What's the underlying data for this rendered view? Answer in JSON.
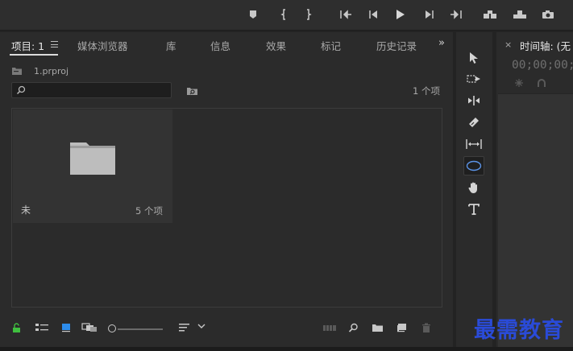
{
  "project_panel": {
    "tabs": [
      {
        "label": "项目: 1",
        "active": true
      },
      {
        "label": "媒体浏览器",
        "active": false
      },
      {
        "label": "库",
        "active": false
      },
      {
        "label": "信息",
        "active": false
      },
      {
        "label": "效果",
        "active": false
      },
      {
        "label": "标记",
        "active": false
      },
      {
        "label": "历史记录",
        "active": false
      }
    ],
    "more_tabs_glyph": "»",
    "project_file": "1.prproj",
    "search": {
      "value": "",
      "placeholder": ""
    },
    "item_count": "1 个项",
    "bin": {
      "name": "未",
      "count": "5 个项"
    },
    "zoom_level": 0.0
  },
  "timeline_panel": {
    "close_glyph": "×",
    "title": "时间轴: (无",
    "timecode": "00;00;00;0"
  },
  "tools": [
    "selection-tool",
    "track-select-tool",
    "ripple-edit-tool",
    "razor-tool",
    "slip-tool",
    "ellipse-tool",
    "hand-tool",
    "type-tool"
  ],
  "active_tool": "ellipse-tool",
  "watermark": "最需教育",
  "colors": {
    "background": "#232323",
    "panel": "#2b2b2b",
    "accent_blue": "#2d8ceb",
    "lock_green": "#3fbf3f",
    "watermark_blue": "#2a4bd8"
  }
}
